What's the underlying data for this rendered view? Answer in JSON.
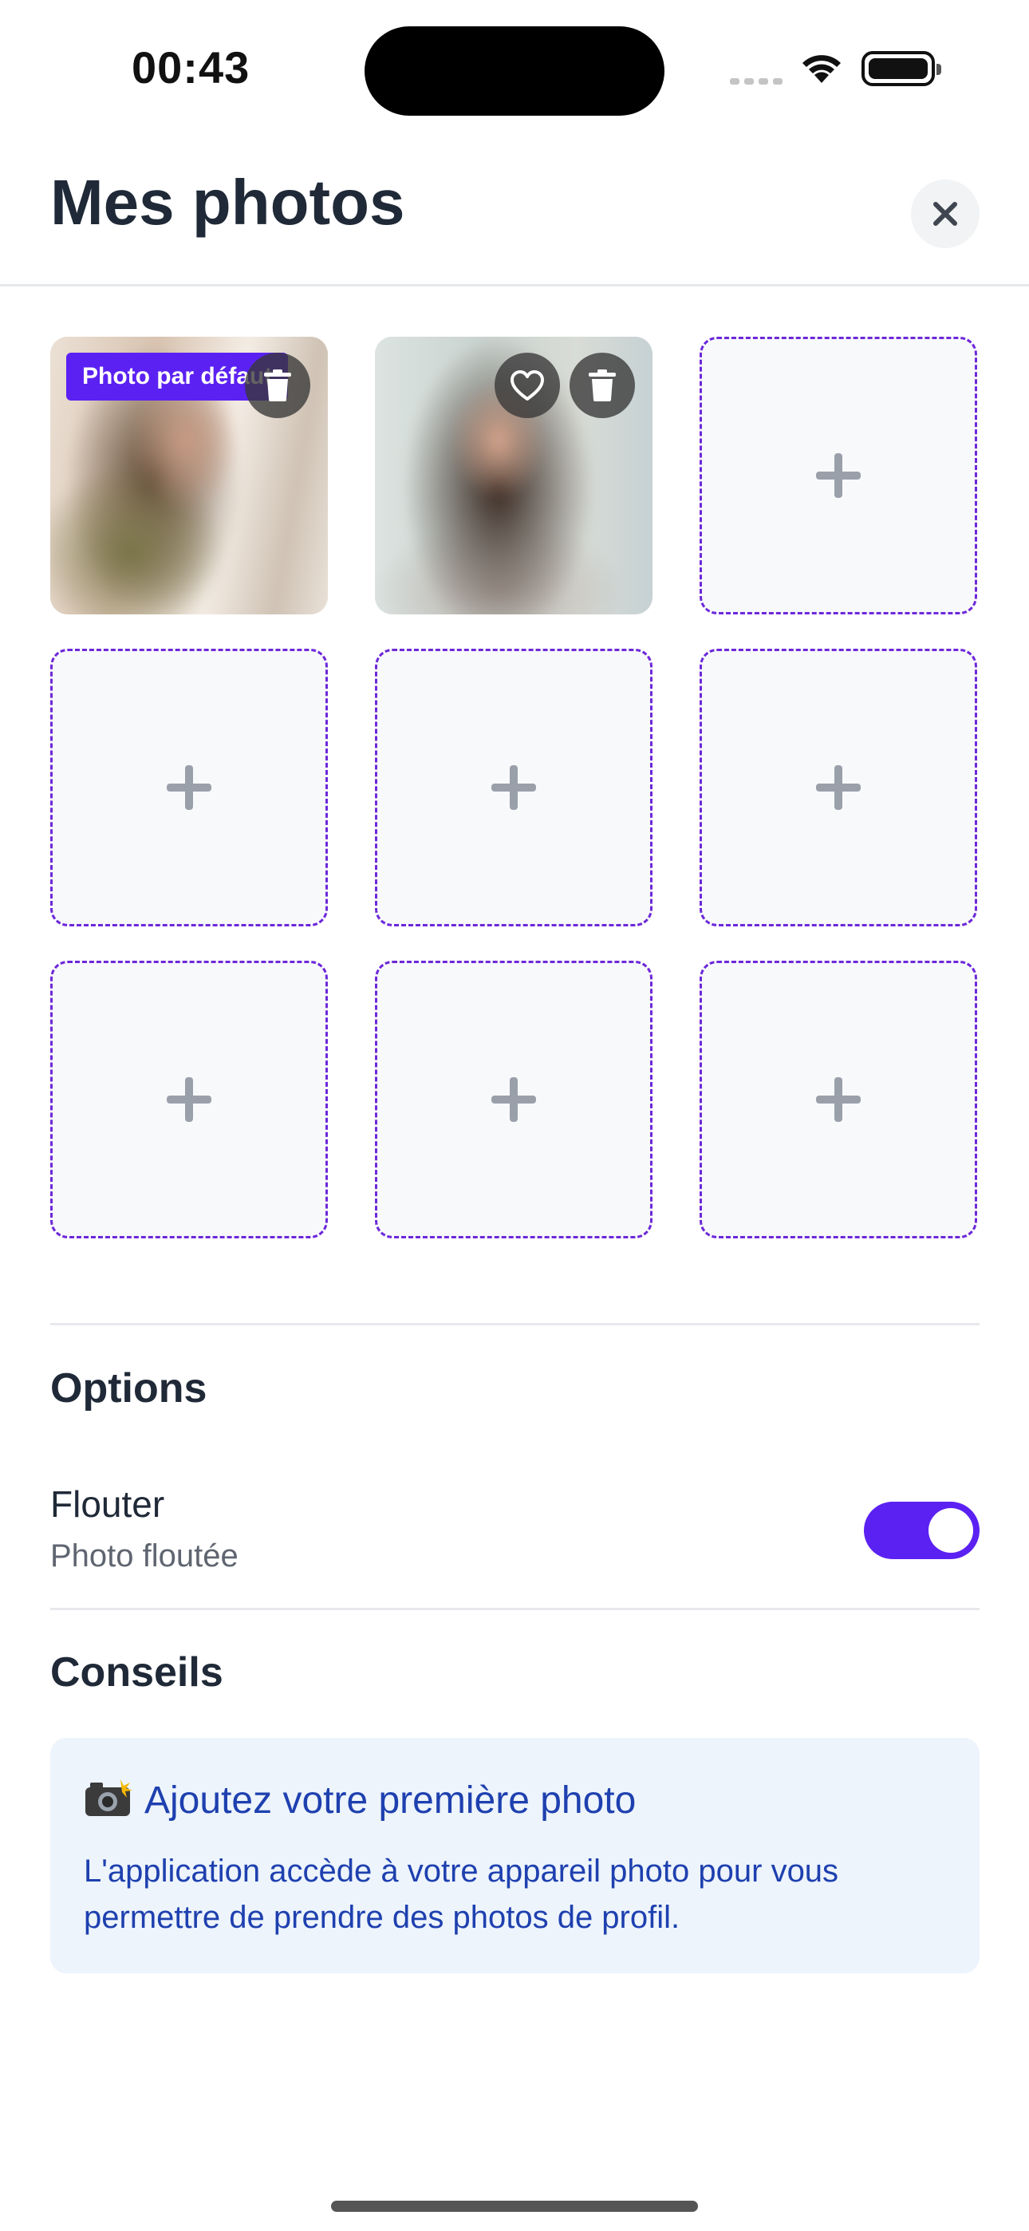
{
  "status_bar": {
    "time": "00:43"
  },
  "header": {
    "title": "Mes photos",
    "close_icon": "close-icon"
  },
  "photos": {
    "filled": [
      {
        "badge": "Photo par défaut",
        "actions": [
          "trash-icon"
        ]
      },
      {
        "actions": [
          "heart-icon",
          "trash-icon"
        ]
      }
    ],
    "empty_slots": 7,
    "add_icon": "plus-icon"
  },
  "options": {
    "title": "Options",
    "blur": {
      "label": "Flouter",
      "subtitle": "Photo floutée",
      "enabled": true
    }
  },
  "tips": {
    "title": "Conseils",
    "card": {
      "emoji": "📸",
      "heading": "Ajoutez votre première photo",
      "text": "L'application accède à votre appareil photo pour vous permettre de prendre des photos de profil."
    }
  },
  "colors": {
    "accent": "#5b21f2",
    "dashed_border": "#6d28d9",
    "tip_background": "#edf4fc",
    "tip_text": "#1e40af"
  }
}
